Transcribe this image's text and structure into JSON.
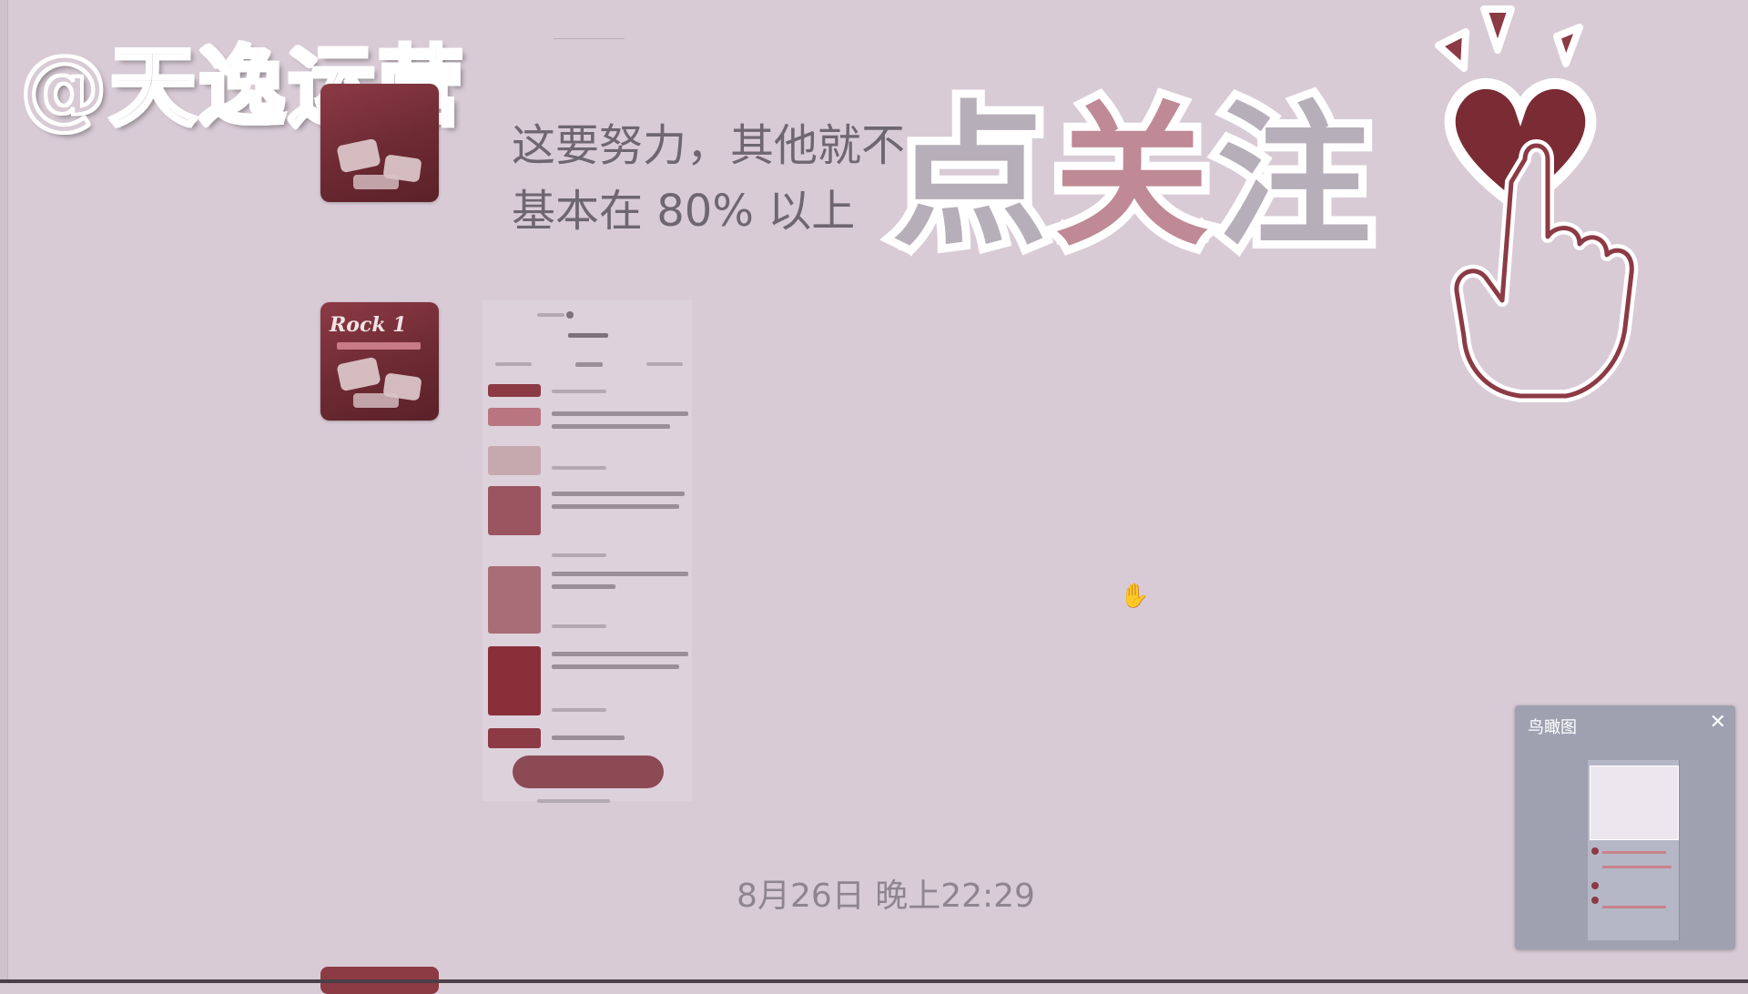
{
  "watermark": {
    "text": "@天逸运营"
  },
  "overlay": {
    "follow_chars": [
      "点",
      "关",
      "注"
    ]
  },
  "chat": {
    "messages": [
      {
        "avatar_title": "Rock 1",
        "text_line1": "这要努力，其他就不",
        "text_line2": "基本在 80% 以上"
      }
    ],
    "timestamp": "8月26日 晚上22:29"
  },
  "navigator": {
    "title": "鸟瞰图",
    "close_glyph": "✕"
  },
  "cursor_glyph": "✋",
  "colors": {
    "background": "#d8cbd6",
    "accent": "#8c3a44",
    "panel": "#9fa1b1"
  }
}
